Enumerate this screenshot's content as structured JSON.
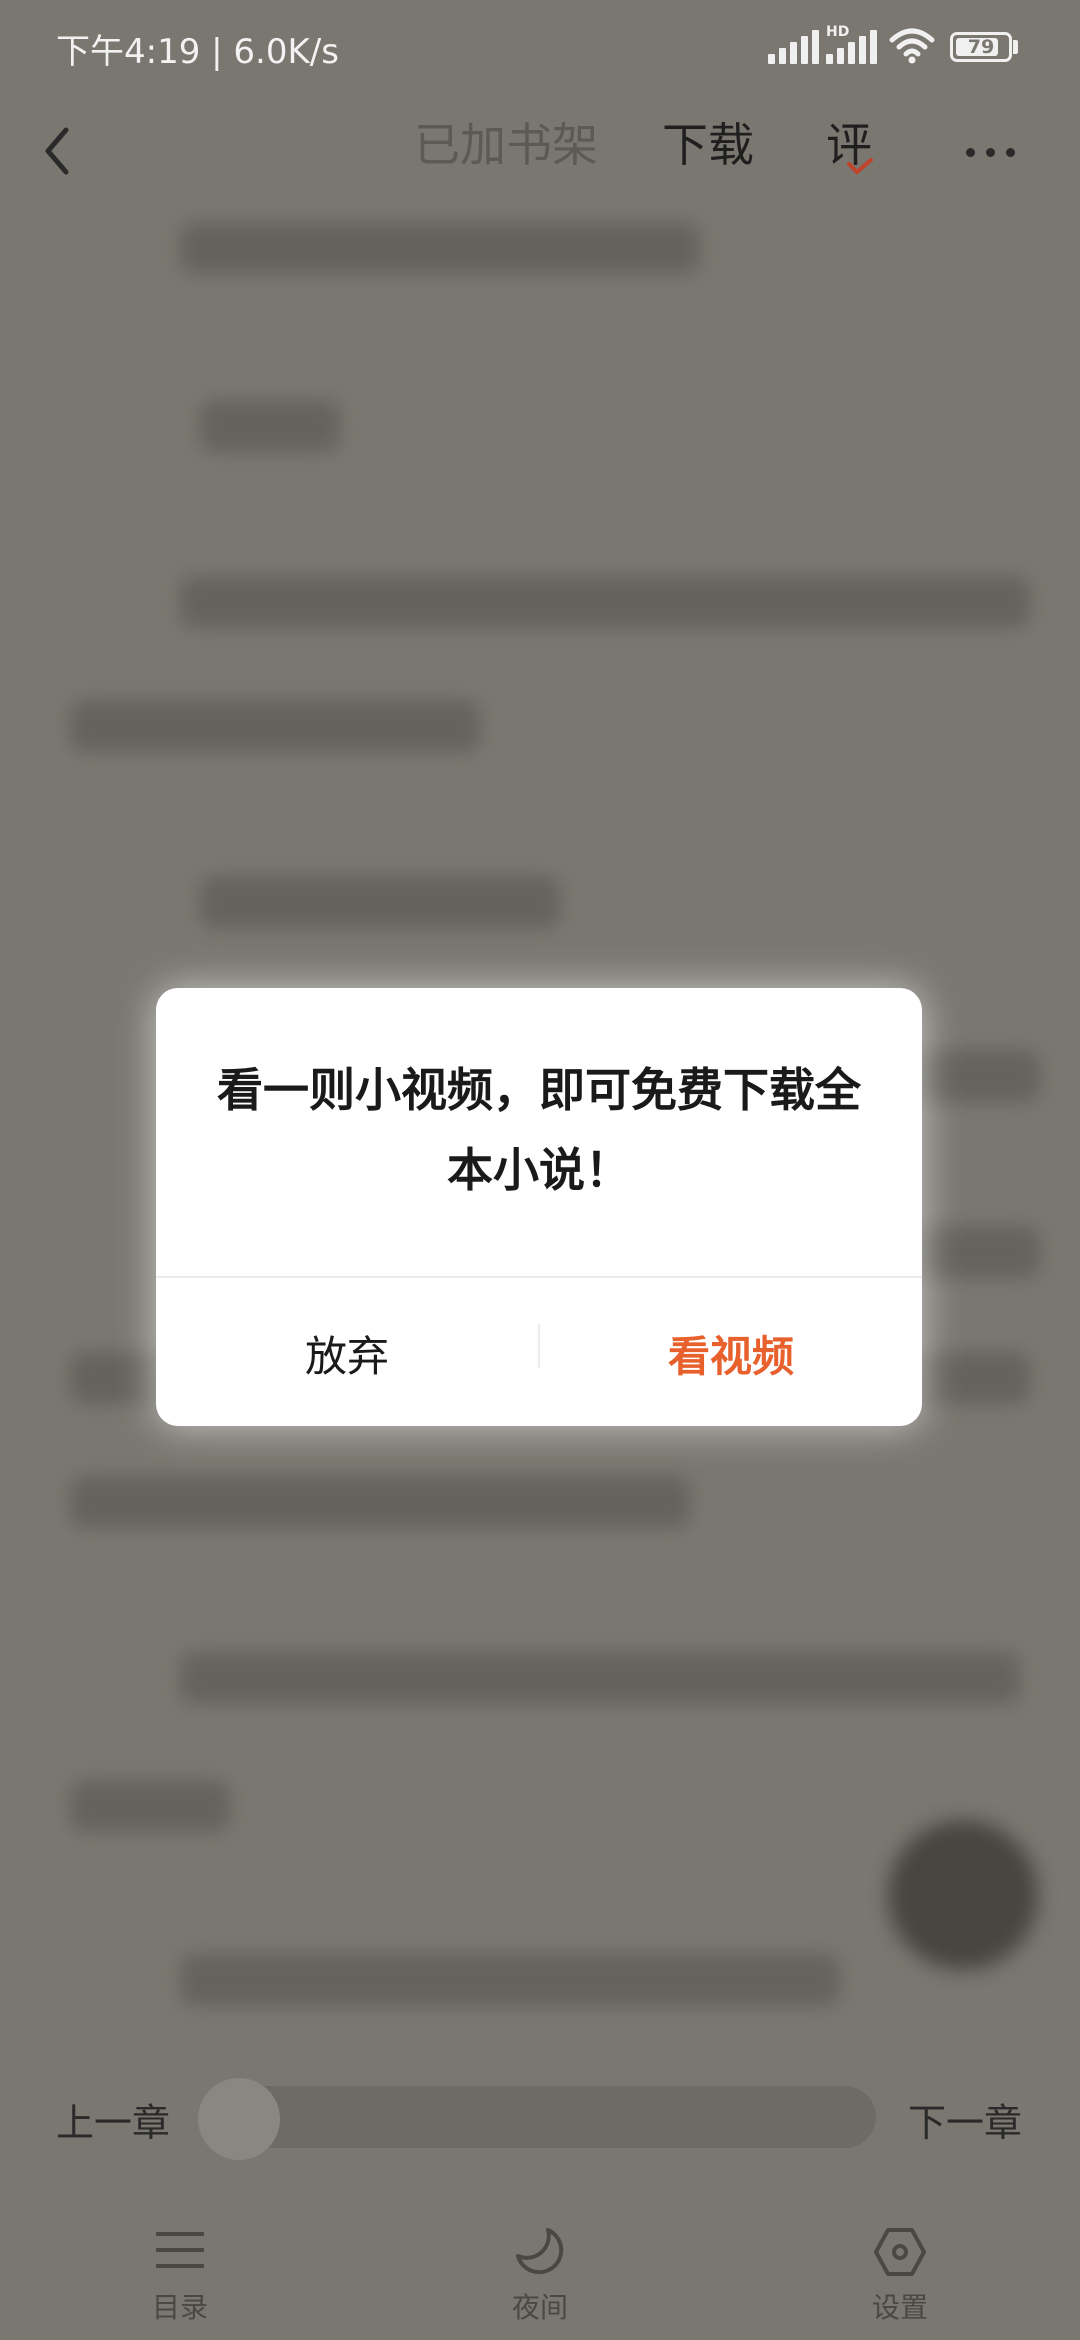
{
  "status": {
    "time_speed": "下午4:19 | 6.0K/s",
    "network_label": "HD",
    "battery": "79",
    "battery_level": 0.79
  },
  "header": {
    "shelf_label": "已加书架",
    "download_label": "下载",
    "review_label": "评"
  },
  "dialog": {
    "message": "看一则小视频，即可免费下载全本小说！",
    "cancel_label": "放弃",
    "confirm_label": "看视频",
    "confirm_color": "#E8602C"
  },
  "reader": {
    "prev_chapter": "上一章",
    "next_chapter": "下一章"
  },
  "tabs": [
    {
      "label": "目录",
      "icon": "menu-icon"
    },
    {
      "label": "夜间",
      "icon": "moon-icon"
    },
    {
      "label": "设置",
      "icon": "settings-icon"
    }
  ]
}
